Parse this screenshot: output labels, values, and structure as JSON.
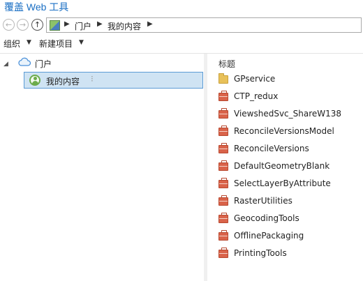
{
  "window": {
    "title": "覆盖 Web 工具"
  },
  "address_bar": {
    "crumbs": [
      "门户",
      "我的内容"
    ],
    "back_icon": "arrow-left-icon",
    "forward_icon": "arrow-right-icon",
    "up_icon": "arrow-up-icon"
  },
  "toolbar": {
    "organize_label": "组织",
    "new_item_label": "新建项目"
  },
  "tree": {
    "root_label": "门户",
    "selected_label": "我的内容",
    "selected_suffix": "⁝"
  },
  "list": {
    "column_header": "标题",
    "items": [
      {
        "label": "GPservice",
        "icon": "folder-icon"
      },
      {
        "label": "CTP_redux",
        "icon": "toolbox-icon"
      },
      {
        "label": "ViewshedSvc_ShareW138",
        "icon": "toolbox-icon"
      },
      {
        "label": "ReconcileVersionsModel",
        "icon": "toolbox-icon"
      },
      {
        "label": "ReconcileVersions",
        "icon": "toolbox-icon"
      },
      {
        "label": "DefaultGeometryBlank",
        "icon": "toolbox-icon"
      },
      {
        "label": "SelectLayerByAttribute",
        "icon": "toolbox-icon"
      },
      {
        "label": "RasterUtilities",
        "icon": "toolbox-icon"
      },
      {
        "label": "GeocodingTools",
        "icon": "toolbox-icon"
      },
      {
        "label": "OfflinePackaging",
        "icon": "toolbox-icon"
      },
      {
        "label": "PrintingTools",
        "icon": "toolbox-icon"
      }
    ]
  },
  "colors": {
    "title": "#1a6fc4",
    "selection_bg": "#cfe3f3",
    "selection_border": "#5b9bd5",
    "folder": "#e8c15a",
    "toolbox": "#d9634a"
  }
}
